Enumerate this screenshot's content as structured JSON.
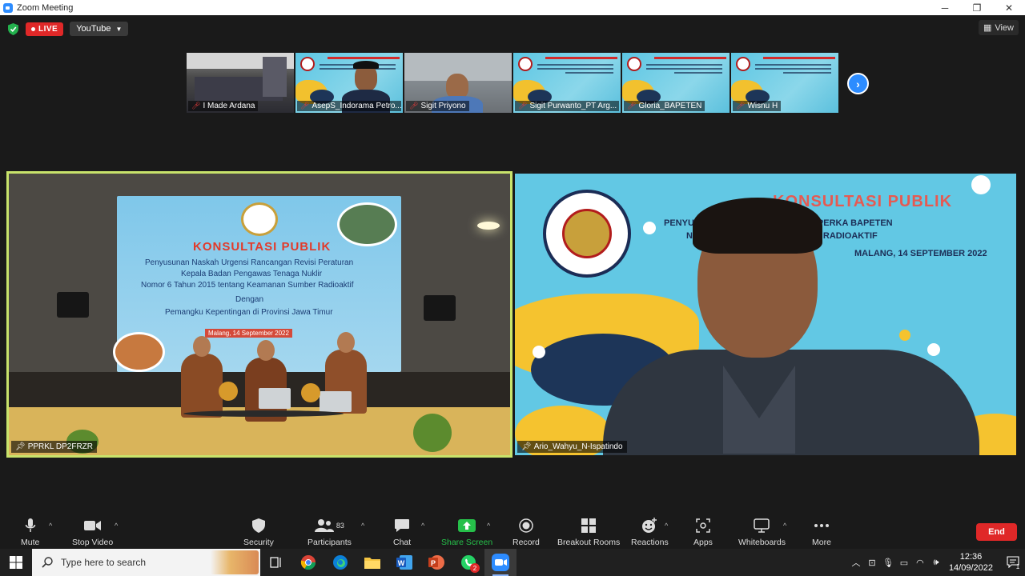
{
  "window": {
    "title": "Zoom Meeting",
    "minimize": "─",
    "maximize": "❐",
    "close": "✕"
  },
  "meeting_header": {
    "live_label": "LIVE",
    "stream_target": "YouTube",
    "view_label": "View"
  },
  "thumbnails": [
    {
      "name": "I Made Ardana",
      "muted": true,
      "type": "room"
    },
    {
      "name": "AsepS_Indorama Petro...",
      "muted": true,
      "type": "poster-person"
    },
    {
      "name": "Sigit Priyono",
      "muted": true,
      "type": "person"
    },
    {
      "name": "Sigit Purwanto_PT Arg...",
      "muted": true,
      "type": "poster"
    },
    {
      "name": "Gloria_BAPETEN",
      "muted": true,
      "type": "poster"
    },
    {
      "name": "Wisnu H",
      "muted": true,
      "type": "poster"
    }
  ],
  "main_left": {
    "name": "PPRKL DP2FRZR",
    "banner": {
      "title": "KONSULTASI PUBLIK",
      "lines": [
        "Penyusunan Naskah Urgensi Rancangan Revisi Peraturan",
        "Kepala Badan Pengawas Tenaga Nuklir",
        "Nomor 6 Tahun 2015 tentang Keamanan Sumber Radioaktif",
        "Dengan",
        "Pemangku Kepentingan di Provinsi Jawa Timur",
        "Malang, 14 September 2022"
      ]
    }
  },
  "main_right": {
    "name": "Ario_Wahyu_N-Ispatindo",
    "poster": {
      "title": "KONSULTASI PUBLIK",
      "line1": "PENYUSUN        SI  RANCANGAN REVISI PERKA BAPETEN",
      "line2": "NO                          TANG KEAMANAN SUMBER RADIOAKTIF",
      "date": "MALANG, 14 SEPTEMBER 2022",
      "emblem_ring": "BADAN PENGAWAS TENAGA NUKLIR",
      "emblem_name": "BAPETEN"
    }
  },
  "toolbar": {
    "mute": "Mute",
    "stop_video": "Stop Video",
    "security": "Security",
    "participants": "Participants",
    "participants_count": "83",
    "chat": "Chat",
    "share_screen": "Share Screen",
    "record": "Record",
    "breakout_rooms": "Breakout Rooms",
    "reactions": "Reactions",
    "apps": "Apps",
    "whiteboards": "Whiteboards",
    "more": "More",
    "end": "End"
  },
  "taskbar": {
    "search_placeholder": "Type here to search",
    "time": "12:36",
    "date": "14/09/2022",
    "notifications": "1",
    "whatsapp_badge": "2"
  },
  "colors": {
    "accent": "#2d8cff",
    "live": "#e02828",
    "share": "#26c04a",
    "speaker_border": "#c8e36b"
  }
}
